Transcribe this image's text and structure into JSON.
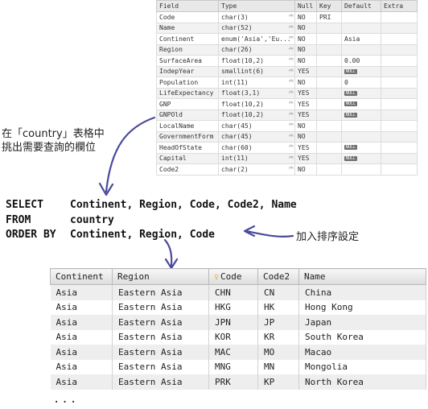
{
  "schema_table": {
    "headers": [
      "Field",
      "Type",
      "Null",
      "Key",
      "Default",
      "Extra"
    ],
    "rows": [
      {
        "field": "Code",
        "type": "char(3)",
        "null": "NO",
        "key": "PRI",
        "default": "",
        "extra": ""
      },
      {
        "field": "Name",
        "type": "char(52)",
        "null": "NO",
        "key": "",
        "default": "",
        "extra": ""
      },
      {
        "field": "Continent",
        "type": "enum('Asia','Eu...",
        "null": "NO",
        "key": "",
        "default": "Asia",
        "extra": ""
      },
      {
        "field": "Region",
        "type": "char(26)",
        "null": "NO",
        "key": "",
        "default": "",
        "extra": ""
      },
      {
        "field": "SurfaceArea",
        "type": "float(10,2)",
        "null": "NO",
        "key": "",
        "default": "0.00",
        "extra": ""
      },
      {
        "field": "IndepYear",
        "type": "smallint(6)",
        "null": "YES",
        "key": "",
        "default": "NULL",
        "extra": ""
      },
      {
        "field": "Population",
        "type": "int(11)",
        "null": "NO",
        "key": "",
        "default": "0",
        "extra": ""
      },
      {
        "field": "LifeExpectancy",
        "type": "float(3,1)",
        "null": "YES",
        "key": "",
        "default": "NULL",
        "extra": ""
      },
      {
        "field": "GNP",
        "type": "float(10,2)",
        "null": "YES",
        "key": "",
        "default": "NULL",
        "extra": ""
      },
      {
        "field": "GNPOld",
        "type": "float(10,2)",
        "null": "YES",
        "key": "",
        "default": "NULL",
        "extra": ""
      },
      {
        "field": "LocalName",
        "type": "char(45)",
        "null": "NO",
        "key": "",
        "default": "",
        "extra": ""
      },
      {
        "field": "GovernmentForm",
        "type": "char(45)",
        "null": "NO",
        "key": "",
        "default": "",
        "extra": ""
      },
      {
        "field": "HeadOfState",
        "type": "char(60)",
        "null": "YES",
        "key": "",
        "default": "NULL",
        "extra": ""
      },
      {
        "field": "Capital",
        "type": "int(11)",
        "null": "YES",
        "key": "",
        "default": "NULL",
        "extra": ""
      },
      {
        "field": "Code2",
        "type": "char(2)",
        "null": "NO",
        "key": "",
        "default": "",
        "extra": ""
      }
    ]
  },
  "annotations": {
    "pick_columns_line1": "在「country」表格中",
    "pick_columns_line2": "挑出需要查詢的欄位",
    "add_sort": "加入排序設定"
  },
  "sql": {
    "line1_kw": "SELECT",
    "line1_rest": "Continent, Region, Code, Code2, Name",
    "line2_kw": "FROM",
    "line2_rest": "country",
    "line3_kw": "ORDER BY",
    "line3_rest": "Continent, Region, Code"
  },
  "result_table": {
    "headers": [
      "Continent",
      "Region",
      "Code",
      "Code2",
      "Name"
    ],
    "key_column_icon": "key-icon",
    "rows": [
      [
        "Asia",
        "Eastern Asia",
        "CHN",
        "CN",
        "China"
      ],
      [
        "Asia",
        "Eastern Asia",
        "HKG",
        "HK",
        "Hong Kong"
      ],
      [
        "Asia",
        "Eastern Asia",
        "JPN",
        "JP",
        "Japan"
      ],
      [
        "Asia",
        "Eastern Asia",
        "KOR",
        "KR",
        "South Korea"
      ],
      [
        "Asia",
        "Eastern Asia",
        "MAC",
        "MO",
        "Macao"
      ],
      [
        "Asia",
        "Eastern Asia",
        "MNG",
        "MN",
        "Mongolia"
      ],
      [
        "Asia",
        "Eastern Asia",
        "PRK",
        "KP",
        "North Korea"
      ]
    ],
    "continuation": "..."
  },
  "colors": {
    "arrow": "#4a4a9c",
    "key_icon": "#e1b21c",
    "null_badge": "#6e6e6e"
  }
}
